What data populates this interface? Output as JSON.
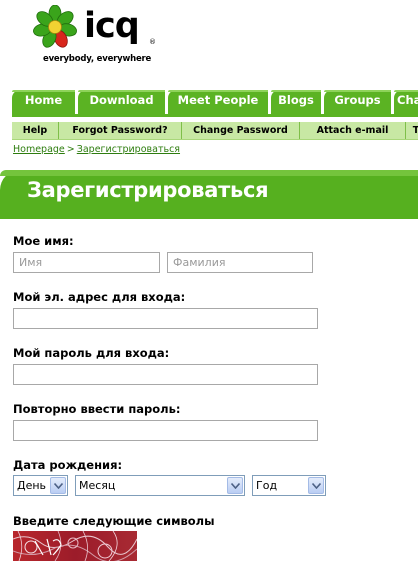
{
  "logo": {
    "wordmark": "icq",
    "registered": "®",
    "tagline": "everybody, everywhere",
    "colors": {
      "petals": "#3aa41b",
      "center": "#d8261c"
    }
  },
  "nav": {
    "tabs": [
      {
        "label": "Home"
      },
      {
        "label": "Download"
      },
      {
        "label": "Meet People"
      },
      {
        "label": "Blogs"
      },
      {
        "label": "Groups"
      },
      {
        "label": "Cha"
      }
    ]
  },
  "subnav": {
    "items": [
      {
        "label": "Help"
      },
      {
        "label": "Forgot Password?"
      },
      {
        "label": "Change Password"
      },
      {
        "label": "Attach e-mail"
      },
      {
        "label": "T"
      }
    ]
  },
  "breadcrumb": {
    "home": "Homepage",
    "separator": ">",
    "current": "Зарегистрироваться"
  },
  "page": {
    "title": "Зарегистрироваться"
  },
  "form": {
    "name_label": "Мое имя:",
    "first_name_placeholder": "Имя",
    "last_name_placeholder": "Фамилия",
    "email_label": "Мой эл. адрес для входа:",
    "email_value": "",
    "password_label": "Мой пароль для входа:",
    "password_value": "",
    "repeat_password_label": "Повторно ввести пароль:",
    "repeat_password_value": "",
    "birthdate_label": "Дата рождения:",
    "day_value": "День",
    "month_value": "Месяц",
    "year_value": "Год",
    "captcha_label": "Введите следующие символы"
  },
  "colors": {
    "brand_green": "#5bb323",
    "subnav_bg": "#c8e8a4",
    "link_green": "#2e7d0f"
  }
}
